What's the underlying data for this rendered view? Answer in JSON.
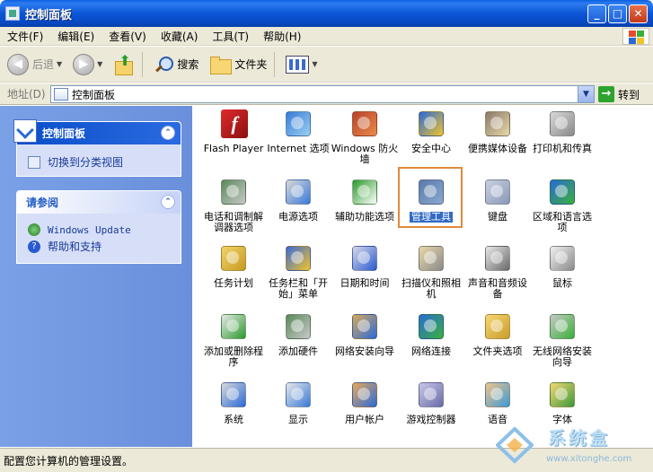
{
  "window": {
    "title": "控制面板"
  },
  "menu": [
    "文件(F)",
    "编辑(E)",
    "查看(V)",
    "收藏(A)",
    "工具(T)",
    "帮助(H)"
  ],
  "toolbar": {
    "back": "后退",
    "search": "搜索",
    "folders": "文件夹"
  },
  "address": {
    "label": "地址(D)",
    "value": "控制面板",
    "go": "转到"
  },
  "sidebar": {
    "panel1": {
      "title": "控制面板",
      "link": "切换到分类视图"
    },
    "panel2": {
      "title": "请参阅",
      "links": [
        "Windows Update",
        "帮助和支持"
      ]
    }
  },
  "items": [
    "Flash Player",
    "Internet 选项",
    "Windows 防火墙",
    "安全中心",
    "便携媒体设备",
    "打印机和传真",
    "电话和调制解调器选项",
    "电源选项",
    "辅助功能选项",
    "管理工具",
    "键盘",
    "区域和语言选项",
    "任务计划",
    "任务栏和「开始」菜单",
    "日期和时间",
    "扫描仪和照相机",
    "声音和音频设备",
    "鼠标",
    "添加或删除程序",
    "添加硬件",
    "网络安装向导",
    "网络连接",
    "文件夹选项",
    "无线网络安装向导",
    "系统",
    "显示",
    "用户帐户",
    "游戏控制器",
    "语音",
    "字体"
  ],
  "selected_item": "管理工具",
  "status": "配置您计算机的管理设置。",
  "watermark": {
    "brand": "系统盒",
    "url": "www.xitonghe.com"
  }
}
